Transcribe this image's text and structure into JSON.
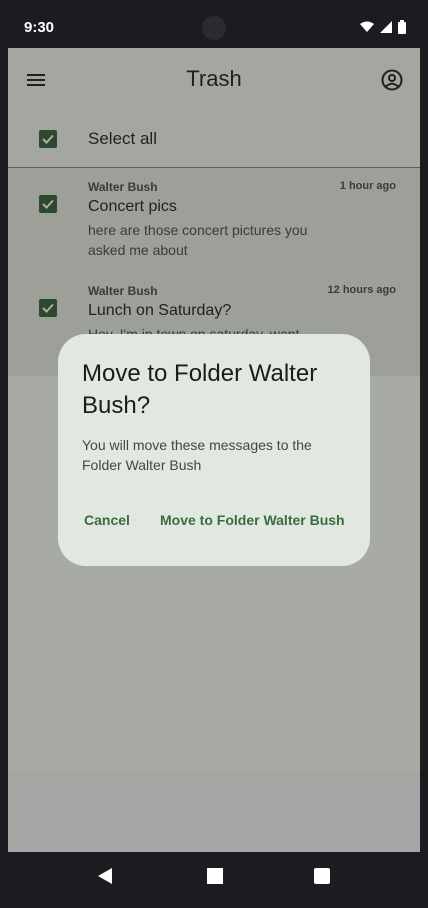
{
  "status_bar": {
    "time": "9:30"
  },
  "app_bar": {
    "title": "Trash",
    "menu_icon": "menu-icon",
    "account_icon": "account-circle-icon"
  },
  "select_all": {
    "label": "Select all",
    "checked": true
  },
  "messages": [
    {
      "sender": "Walter Bush",
      "time": "1 hour ago",
      "subject": "Concert pics",
      "preview": "here are those concert pictures you asked me about",
      "checked": true
    },
    {
      "sender": "Walter Bush",
      "time": "12 hours ago",
      "subject": "Lunch on Saturday?",
      "preview": "Hey, I'm in town on saturday, want",
      "checked": true
    }
  ],
  "dialog": {
    "title": "Move to Folder Walter Bush?",
    "body": "You will move these messages to the Folder Walter Bush",
    "cancel_label": "Cancel",
    "confirm_label": "Move to Folder Walter Bush"
  },
  "colors": {
    "accent": "#2f5a34",
    "button_text": "#3a6b41",
    "dialog_bg": "#e1e8df"
  }
}
